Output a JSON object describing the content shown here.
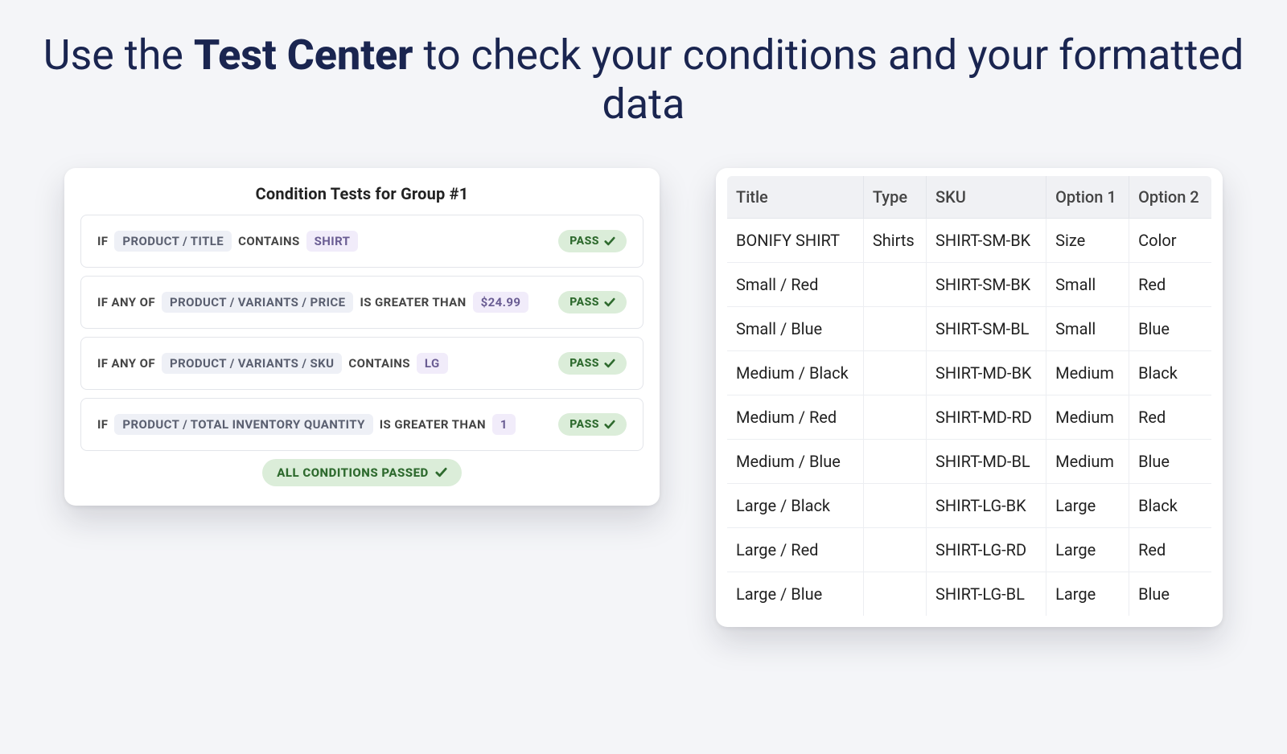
{
  "headline": {
    "pre": "Use the ",
    "bold": "Test Center",
    "post": " to check your conditions and your formatted data"
  },
  "conditions": {
    "title": "Condition Tests for Group #1",
    "rows": [
      {
        "prefix": "IF",
        "field": "PRODUCT / TITLE",
        "op": "CONTAINS",
        "value": "SHIRT",
        "status": "PASS"
      },
      {
        "prefix": "IF ANY OF",
        "field": "PRODUCT / VARIANTS / PRICE",
        "op": "IS GREATER THAN",
        "value": "$24.99",
        "status": "PASS"
      },
      {
        "prefix": "IF ANY OF",
        "field": "PRODUCT / VARIANTS / SKU",
        "op": "CONTAINS",
        "value": "LG",
        "status": "PASS"
      },
      {
        "prefix": "IF",
        "field": "PRODUCT / TOTAL INVENTORY QUANTITY",
        "op": "IS GREATER THAN",
        "value": "1",
        "status": "PASS"
      }
    ],
    "summary": "ALL CONDITIONS PASSED"
  },
  "datatable": {
    "headers": [
      "Title",
      "Type",
      "SKU",
      "Option 1",
      "Option 2"
    ],
    "rows": [
      [
        "BONIFY SHIRT",
        "Shirts",
        "SHIRT-SM-BK",
        "Size",
        "Color"
      ],
      [
        "Small / Red",
        "",
        "SHIRT-SM-BK",
        "Small",
        "Red"
      ],
      [
        "Small / Blue",
        "",
        "SHIRT-SM-BL",
        "Small",
        "Blue"
      ],
      [
        "Medium / Black",
        "",
        "SHIRT-MD-BK",
        "Medium",
        "Black"
      ],
      [
        "Medium / Red",
        "",
        "SHIRT-MD-RD",
        "Medium",
        "Red"
      ],
      [
        "Medium / Blue",
        "",
        "SHIRT-MD-BL",
        "Medium",
        "Blue"
      ],
      [
        "Large / Black",
        "",
        "SHIRT-LG-BK",
        "Large",
        "Black"
      ],
      [
        "Large / Red",
        "",
        "SHIRT-LG-RD",
        "Large",
        "Red"
      ],
      [
        "Large / Blue",
        "",
        "SHIRT-LG-BL",
        "Large",
        "Blue"
      ]
    ]
  }
}
